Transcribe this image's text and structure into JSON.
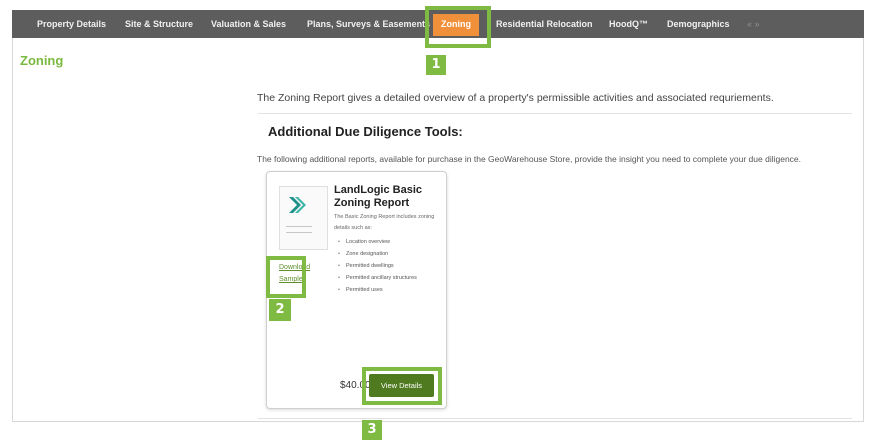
{
  "nav": {
    "items": [
      {
        "label": "Property Details",
        "active": false
      },
      {
        "label": "Site & Structure",
        "active": false
      },
      {
        "label": "Valuation & Sales",
        "active": false
      },
      {
        "label": "Plans, Surveys & Easements",
        "active": false
      },
      {
        "label": "Zoning",
        "active": true
      },
      {
        "label": "Residential Relocation",
        "active": false
      },
      {
        "label": "HoodQ™",
        "active": false
      },
      {
        "label": "Demographics",
        "active": false
      }
    ],
    "more": "« »"
  },
  "page": {
    "title": "Zoning",
    "intro": "The Zoning Report gives a detailed overview of a property's permissible activities and associated requriements.",
    "section_title": "Additional Due Diligence Tools:",
    "section_sub": "The following additional reports, available for purchase in the GeoWarehouse Store, provide the insight you need to complete your due diligence."
  },
  "card": {
    "title": "LandLogic Basic Zoning Report",
    "description": "The Basic Zoning Report includes zoning details such as:",
    "bullets": [
      "Location overview",
      "Zone designation",
      "Permitted dwellings",
      "Permitted ancillary structures",
      "Permitted uses"
    ],
    "download_label": "Download Sample",
    "price": "$40.00",
    "button_label": "View Details"
  },
  "callouts": [
    "1",
    "2",
    "3"
  ],
  "colors": {
    "nav_bg": "#5d5d5d",
    "active_tab": "#f0903a",
    "accent_green": "#7fba42",
    "button_green": "#4f7a1f",
    "title_green": "#7ab940"
  }
}
